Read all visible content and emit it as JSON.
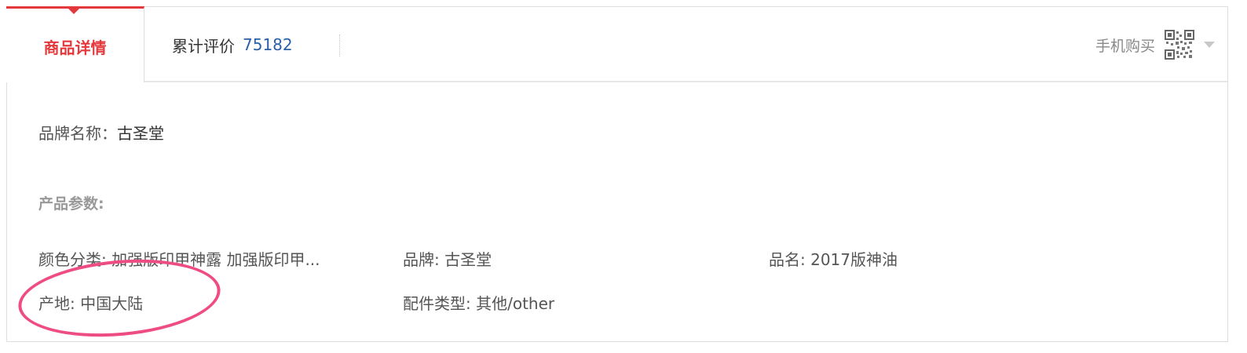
{
  "tabs": {
    "details_label": "商品详情",
    "reviews_label": "累计评价",
    "reviews_count": "75182",
    "mobile_buy_label": "手机购买"
  },
  "brand": {
    "label": "品牌名称：",
    "value": "古圣堂"
  },
  "params": {
    "title": "产品参数:",
    "items": [
      "颜色分类: 加强版印甲神露 加强版印甲...",
      "品牌: 古圣堂",
      "品名: 2017版神油",
      "产地: 中国大陆",
      "配件类型: 其他/other"
    ]
  },
  "icons": {
    "qr": "qr-code-icon",
    "dropdown": "chevron-down-icon"
  },
  "colors": {
    "accent": "#e4393c",
    "link": "#2a5fa8",
    "annotation": "#ee4d84"
  }
}
